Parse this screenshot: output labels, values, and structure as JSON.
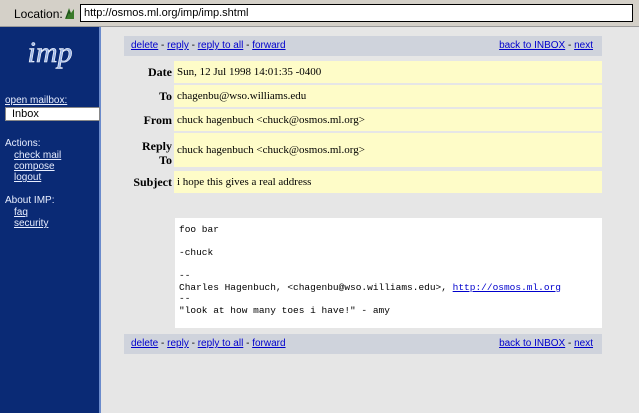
{
  "location_bar": {
    "label": "Location:",
    "url": "http://osmos.ml.org/imp/imp.shtml",
    "icon": "bookmark-icon"
  },
  "sidebar": {
    "logo_text": "imp",
    "open_mailbox_label": "open mailbox:",
    "mailbox_selected": "Inbox",
    "actions_heading": "Actions:",
    "actions": [
      "check mail",
      "compose",
      "logout"
    ],
    "about_heading": "About IMP:",
    "about": [
      "faq",
      "security"
    ]
  },
  "toolbar": {
    "delete": "delete",
    "reply": "reply",
    "reply_to_all": "reply to all",
    "forward": "forward",
    "back_to_inbox": "back to INBOX",
    "next": "next",
    "separator": " - "
  },
  "headers": {
    "date_label": "Date",
    "date_value": "Sun, 12 Jul 1998 14:01:35 -0400",
    "to_label": "To",
    "to_value": "chagenbu@wso.williams.edu",
    "from_label": "From",
    "from_value": "chuck hagenbuch <chuck@osmos.ml.org>",
    "replyto_label_line1": "Reply",
    "replyto_label_line2": "To",
    "replyto_value": "chuck hagenbuch <chuck@osmos.ml.org>",
    "subject_label": "Subject",
    "subject_value": "i hope this gives a real address"
  },
  "message": {
    "line1": "foo bar",
    "line2": "-chuck",
    "sig_sep1": "--",
    "sig_name": "Charles Hagenbuch, <chagenbu@wso.williams.edu>, ",
    "sig_link": "http://osmos.ml.org",
    "sig_sep2": "--",
    "sig_quote": "\"look at how many toes i have!\" - amy"
  },
  "colors": {
    "sidebar_bg": "#0a2a75",
    "header_value_bg": "#fefcc8",
    "link": "#0000cc",
    "navbar_bg": "#cfd3dc"
  }
}
